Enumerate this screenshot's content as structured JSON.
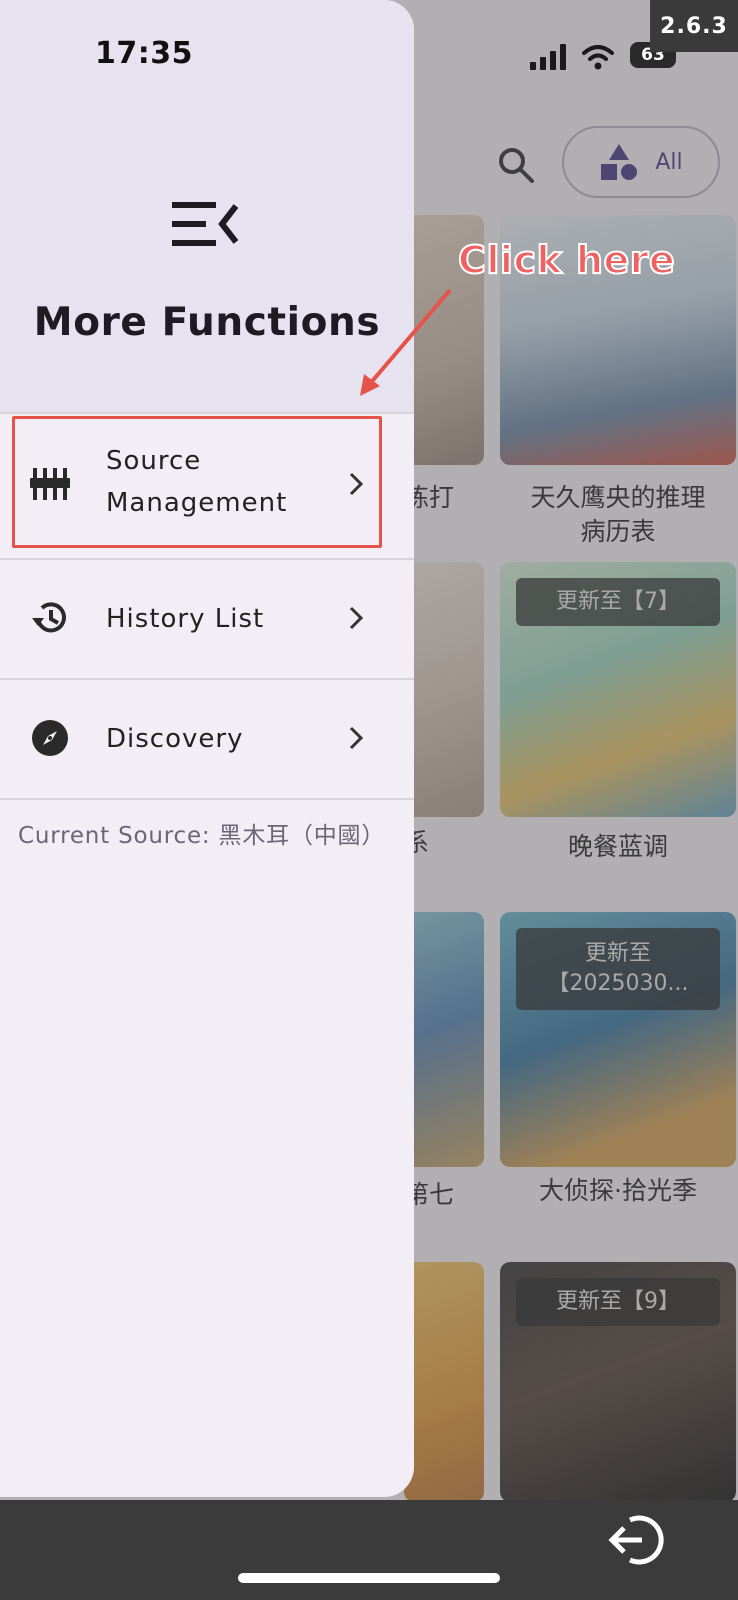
{
  "status_bar": {
    "time": "17:35",
    "battery": "63"
  },
  "version_badge": "2.6.3",
  "drawer": {
    "title": "More Functions",
    "items": [
      {
        "label_line1": "Source",
        "label_line2": "Management",
        "icon": "tune-icon"
      },
      {
        "label": "History List",
        "icon": "history-icon"
      },
      {
        "label": "Discovery",
        "icon": "compass-icon"
      }
    ],
    "current_source": "Current Source: 黑木耳（中國）"
  },
  "annotation": {
    "text": "Click here"
  },
  "background": {
    "filter_label": "All",
    "cards": [
      {
        "badge": "",
        "title": "天久鹰央的推理\n病历表"
      },
      {
        "badge": "更新至【7】",
        "title": "晚餐蓝调"
      },
      {
        "badge": "更新至\n【2025030...",
        "title": "大侦探·拾光季"
      },
      {
        "badge": "更新至【9】",
        "title": ""
      }
    ],
    "left_fragments": [
      "练打",
      "系",
      "第七"
    ]
  },
  "colors": {
    "accent": "#4a3f8a",
    "highlight": "#e5534b",
    "drawer_bg": "#f3eef6",
    "header_bg": "#e6e2f0"
  }
}
